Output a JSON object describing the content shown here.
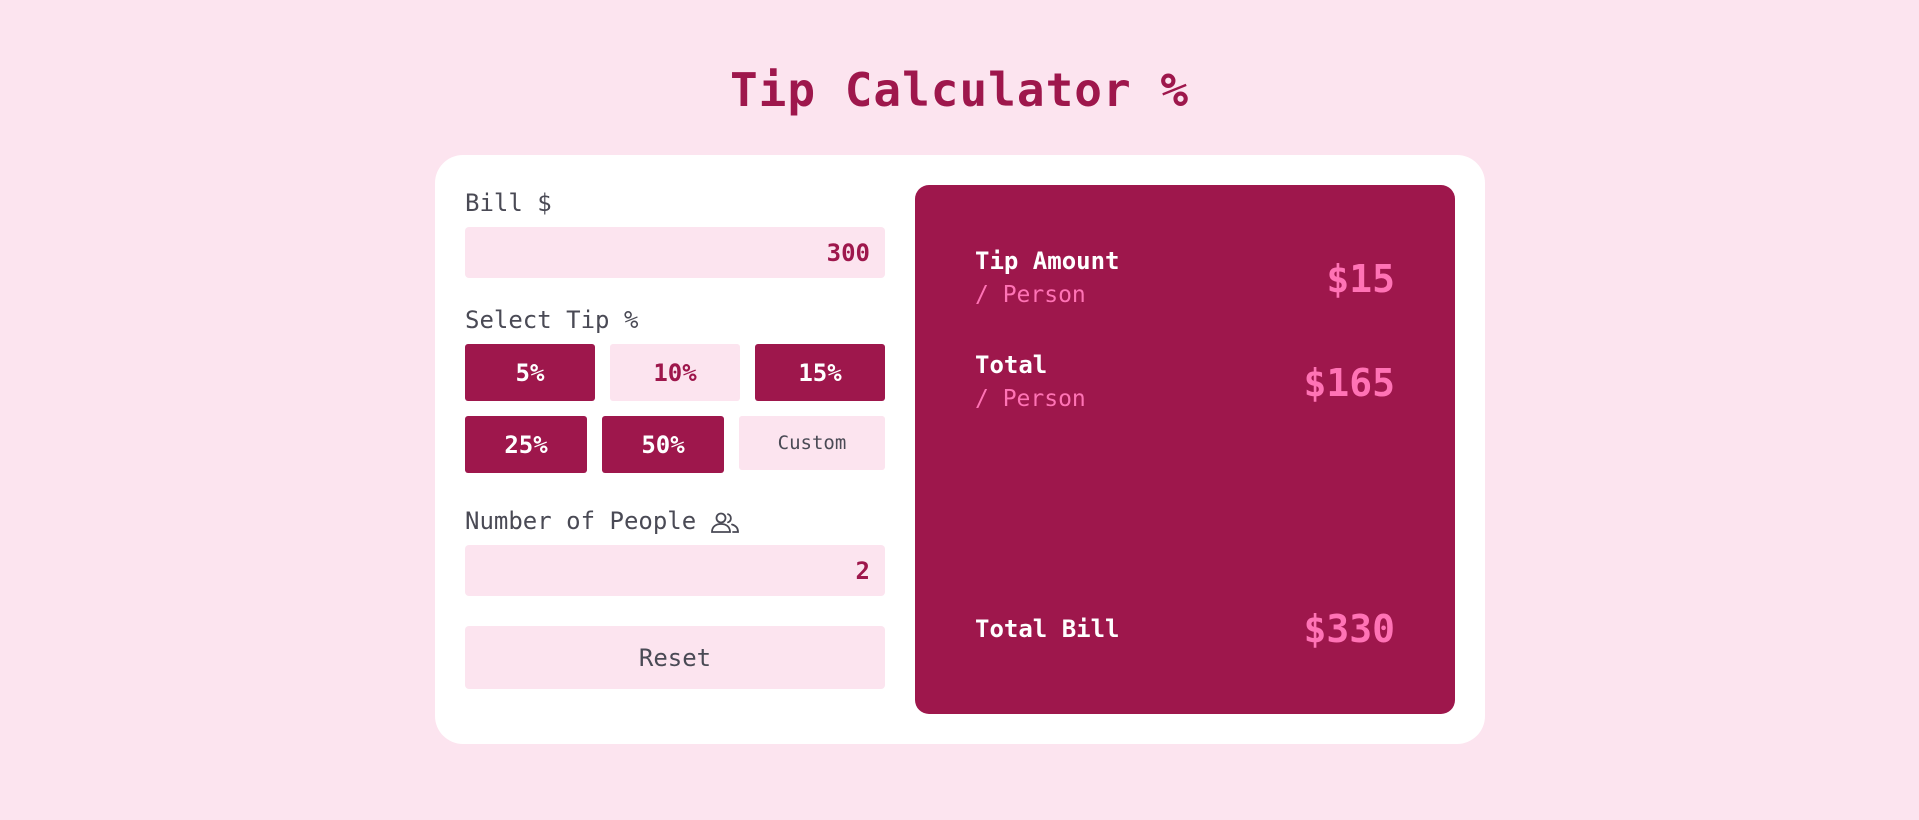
{
  "app": {
    "title": "Tip Calculator %"
  },
  "bill": {
    "label": "Bill $",
    "value": "300"
  },
  "tip": {
    "label": "Select Tip %",
    "options": [
      "5%",
      "10%",
      "15%",
      "25%",
      "50%"
    ],
    "custom_label": "Custom"
  },
  "people": {
    "label": "Number of People",
    "icon": "people-icon",
    "value": "2"
  },
  "reset_label": "Reset",
  "results": {
    "tip_amount_label": "Tip Amount",
    "tip_amount_sub": "/ Person",
    "tip_amount_value": "$15",
    "total_label": "Total",
    "total_sub": "/ Person",
    "total_value": "$165",
    "total_bill_label": "Total Bill",
    "total_bill_value": "$330"
  },
  "colors": {
    "background": "#fce4ef",
    "accent": "#9e174c",
    "highlight": "#ff73b5",
    "card": "#ffffff"
  }
}
